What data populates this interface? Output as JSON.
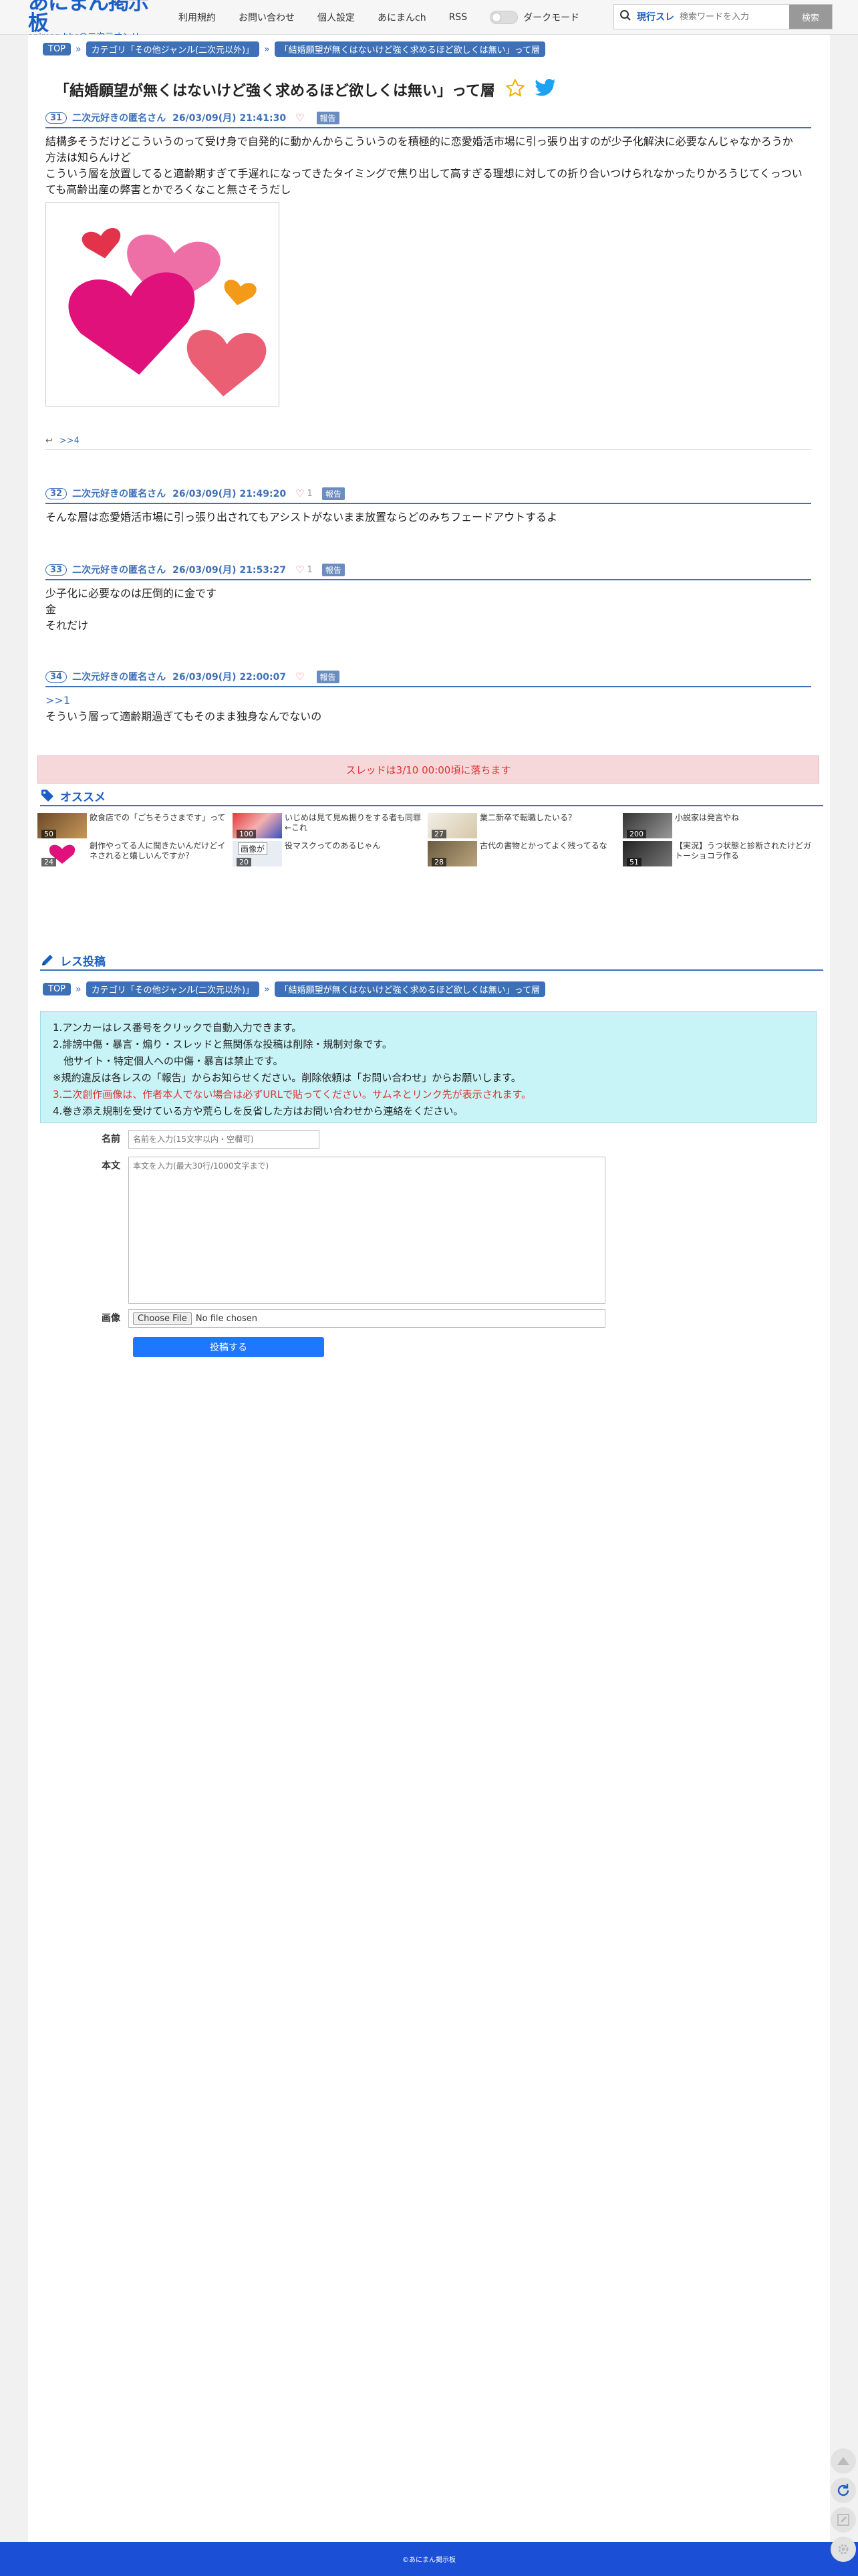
{
  "header": {
    "logo_main": "あにまん掲示板",
    "logo_sub": "animan bbs@二次元オンリー",
    "nav": [
      "利用規約",
      "お問い合わせ",
      "個人設定",
      "あにまんch",
      "RSS"
    ],
    "dark_mode_label": "ダークモード",
    "search_label": "現行スレ",
    "search_placeholder": "検索ワードを入力",
    "search_button": "検索"
  },
  "breadcrumb": {
    "top": "TOP",
    "category": "カテゴリ「その他ジャンル(二次元以外)」",
    "thread": "「結婚願望が無くはないけど強く求めるほど欲しくは無い」って層"
  },
  "thread_title": "「結婚願望が無くはないけど強く求めるほど欲しくは無い」って層",
  "posts": [
    {
      "num": "31",
      "name": "二次元好きの匿名さん",
      "date": "26/03/09(月) 21:41:30",
      "likes": "",
      "report": "報告",
      "lines": [
        "結構多そうだけどこういうのって受け身で自発的に動かんからこういうのを積極的に恋愛婚活市場に引っ張り出すのが少子化解決に必要なんじゃなかろうか",
        "方法は知らんけど",
        "こういう層を放置してると適齢期すぎて手遅れになってきたタイミングで焦り出して高すぎる理想に対しての折り合いつけられなかったりかろうじてくっついても高齢出産の弊害とかでろくなこと無さそうだし"
      ]
    },
    {
      "num": "32",
      "name": "二次元好きの匿名さん",
      "date": "26/03/09(月) 21:49:20",
      "likes": "1",
      "report": "報告",
      "lines": [
        "そんな層は恋愛婚活市場に引っ張り出されてもアシストがないまま放置ならどのみちフェードアウトするよ"
      ]
    },
    {
      "num": "33",
      "name": "二次元好きの匿名さん",
      "date": "26/03/09(月) 21:53:27",
      "likes": "1",
      "report": "報告",
      "lines": [
        "少子化に必要なのは圧倒的に金です",
        "金",
        "それだけ"
      ]
    },
    {
      "num": "34",
      "name": "二次元好きの匿名さん",
      "date": "26/03/09(月) 22:00:07",
      "likes": "",
      "report": "報告",
      "anchor": ">>1",
      "lines": [
        "そういう層って適齢期過ぎてもそのまま独身なんでないの"
      ]
    }
  ],
  "reply_link": ">>4",
  "notice": "スレッドは3/10 00:00頃に落ちます",
  "recommend": {
    "heading": "オススメ",
    "items": [
      {
        "count": "50",
        "text": "飲食店での「ごちそうさまです」って"
      },
      {
        "count": "100",
        "text": "いじめは見て見ぬ振りをする者も同罪←これ"
      },
      {
        "count": "27",
        "text": "業二新卒で転職したいる？"
      },
      {
        "count": "200",
        "text": "小説家は発言やね"
      },
      {
        "count": "24",
        "text": "創作やってる人に聞きたいんだけどイネされると嬉しいんですか？"
      },
      {
        "count": "20",
        "text": "役マスクってのあるじゃん",
        "label": "画像が"
      },
      {
        "count": "28",
        "text": "古代の書物とかってよく残ってるな"
      },
      {
        "count": "51",
        "text": "【実況】うつ状態と診断されたけどガトーショコラ作る"
      }
    ]
  },
  "form": {
    "heading": "レス投稿",
    "notes": [
      "1.アンカーはレス番号をクリックで自動入力できます。",
      "2.誹謗中傷・暴言・煽り・スレッドと無関係な投稿は削除・規制対象です。",
      "他サイト・特定個人への中傷・暴言は禁止です。",
      "※規約違反は各レスの「報告」からお知らせください。削除依頼は「お問い合わせ」からお願いします。",
      "3.二次創作画像は、作者本人でない場合は必ずURLで貼ってください。サムネとリンク先が表示されます。",
      "4.巻き添え規制を受けている方や荒らしを反省した方はお問い合わせから連絡をください。"
    ],
    "name_label": "名前",
    "name_placeholder": "名前を入力(15文字以内・空欄可)",
    "body_label": "本文",
    "body_placeholder": "本文を入力(最大30行/1000文字まで)",
    "image_label": "画像",
    "file_button": "Choose File",
    "file_status": "No file chosen",
    "submit": "投稿する"
  },
  "footer": "©あにまん掲示板"
}
